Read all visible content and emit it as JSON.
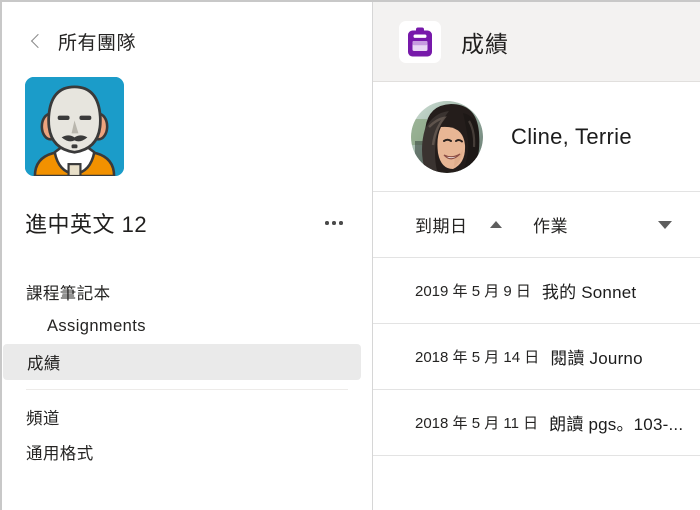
{
  "sidebar": {
    "back": {
      "label": "所有團隊",
      "icon": "chevron-left-icon"
    },
    "team": {
      "name": "進中英文 12",
      "avatar_alt": "Shakespeare team avatar",
      "avatar_bg": "#1b9cc9",
      "more_label": "更多選項"
    },
    "nav": [
      {
        "key": "class-notebook",
        "label": "課程筆記本",
        "indented": false,
        "selected": false
      },
      {
        "key": "assignments",
        "label": "Assignments",
        "indented": true,
        "selected": false
      },
      {
        "key": "grades",
        "label": "成績",
        "indented": false,
        "selected": true
      }
    ],
    "nav_secondary": [
      {
        "key": "channels",
        "label": "頻道",
        "indented": false,
        "selected": false
      },
      {
        "key": "general",
        "label": "通用格式",
        "indented": false,
        "selected": false
      }
    ]
  },
  "panel": {
    "header": {
      "title": "成績",
      "icon": "clipboard-icon",
      "icon_color": "#7719aa",
      "background": "#f3f2f1"
    },
    "student": {
      "name": "Cline,  Terrie",
      "avatar_alt": "Terrie Cline profile photo"
    },
    "table": {
      "columns": [
        {
          "key": "due_date",
          "label": "到期日",
          "sort": "asc",
          "sort_icon": "caret-up-icon"
        },
        {
          "key": "assignment",
          "label": "作業",
          "sort": "desc",
          "sort_icon": "caret-down-icon"
        }
      ],
      "rows": [
        {
          "due_date": "2019 年 5 月 9 日",
          "assignment": "我的 Sonnet"
        },
        {
          "due_date": "2018 年 5 月 14 日",
          "assignment": "閱讀 Journo"
        },
        {
          "due_date": "2018 年 5 月 11 日",
          "assignment": "朗讀 pgs。103-..."
        }
      ]
    }
  }
}
